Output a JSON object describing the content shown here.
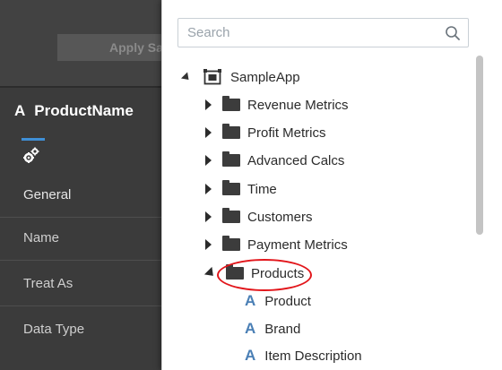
{
  "toolbar": {
    "apply_label": "Apply Sa"
  },
  "properties": {
    "title": "ProductName",
    "title_icon": "attribute-icon",
    "tab_icon": "gears-icon",
    "rows": [
      "General",
      "Name",
      "Treat As",
      "Data Type"
    ]
  },
  "popup": {
    "search": {
      "placeholder": "Search",
      "icon": "search-icon"
    },
    "root": {
      "label": "SampleApp",
      "icon": "subject-area-icon",
      "expanded": true
    },
    "folders": [
      {
        "label": "Revenue Metrics",
        "expanded": false
      },
      {
        "label": "Profit Metrics",
        "expanded": false
      },
      {
        "label": "Advanced Calcs",
        "expanded": false
      },
      {
        "label": "Time",
        "expanded": false
      },
      {
        "label": "Customers",
        "expanded": false
      },
      {
        "label": "Payment Metrics",
        "expanded": false
      },
      {
        "label": "Products",
        "expanded": true,
        "highlighted": true
      }
    ],
    "product_children": [
      {
        "label": "Product",
        "icon": "attribute-icon"
      },
      {
        "label": "Brand",
        "icon": "attribute-icon"
      },
      {
        "label": "Item Description",
        "icon": "attribute-icon"
      }
    ]
  },
  "colors": {
    "highlight_ring": "#e2161b",
    "accent": "#3f8fd6",
    "attribute_icon": "#4a7fb5",
    "dark_pane": "#3b3b3b"
  }
}
